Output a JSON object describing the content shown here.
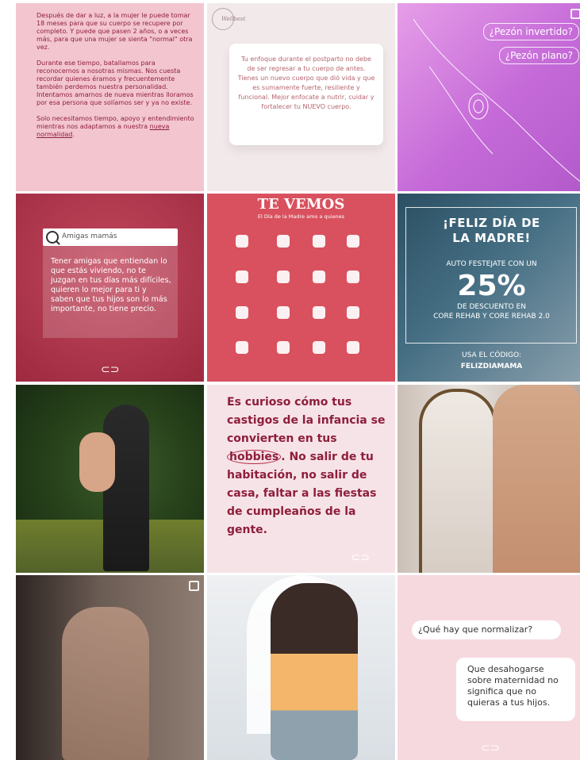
{
  "tiles": {
    "postpartum_recovery": {
      "p1": "Después de dar a luz, a la mujer le puede tomar 18 meses para que su cuerpo se recupere por completo. Y puede que pasen 2 años, o a veces más, para que una mujer se sienta \"normal\" otra vez.",
      "p2": "Durante ese tiempo, batallamos para reconocernos a nosotras mismas. Nos cuesta recordar quienes éramos y frecuentemente también perdemos nuestra personalidad. Intentamos amarnos de nueva mientras lloramos por esa persona que solíamos ser y ya no existe.",
      "p3_a": "Solo necesitamos tiempo, apoyo y entendimiento mientras nos adaptamos a nuestra ",
      "p3_link": "nueva normalidad",
      "p3_end": "."
    },
    "focus_card": {
      "logo": "Wellbest",
      "text": "Tu enfoque durante el postparto no debe de ser regresar a tu cuerpo de antes. Tienes un nuevo cuerpo que dió vida y que es sumamente fuerte, resiliente y funcional. Mejor enfocate a nutrir, cuidar y fortalecer tu NUEVO cuerpo."
    },
    "nipple": {
      "pill1": "¿Pezón invertido?",
      "pill2": "¿Pezón plano?"
    },
    "search_post": {
      "query": "Amigas mamás",
      "text": "Tener amigas que entiendan lo que estás viviendo, no te juzgan en tus días más difíciles, quieren lo mejor para ti y saben que tus hijos son lo más importante, no tiene precio.",
      "loop": "⊂⊃"
    },
    "te_vemos": {
      "title": "TE VEMOS",
      "subtitle": "El Día de la Madre amo a quienes"
    },
    "mothers_day": {
      "line1": "¡FELIZ DÍA DE",
      "line2": "LA MADRE!",
      "line3": "AUTO FESTEJATE CON UN",
      "percent": "25%",
      "line4": "DE DESCUENTO EN",
      "line5": "CORE REHAB Y CORE REHAB 2.0",
      "line6": "USA EL CÓDIGO:",
      "code": "FELIZDIAMAMA"
    },
    "hobbies": {
      "pre": "Es curioso cómo tus castigos de la infancia se convierten en tus ",
      "circled": "hobbies",
      "post": ". No salir de tu habitación, no salir de casa, faltar a las fiestas de cumpleaños de la gente.",
      "loop": "⊂⊃"
    },
    "normalize": {
      "question": "¿Qué hay que normalizar?",
      "answer": "Que desahogarse sobre maternidad no significa que no quieras a tus hijos.",
      "loop": "⊂⊃"
    }
  },
  "colors": {
    "burgundy": "#8e1e3b",
    "coral": "#d9515e",
    "lavender": "#c56ad8",
    "blush": "#f3c6cf"
  }
}
